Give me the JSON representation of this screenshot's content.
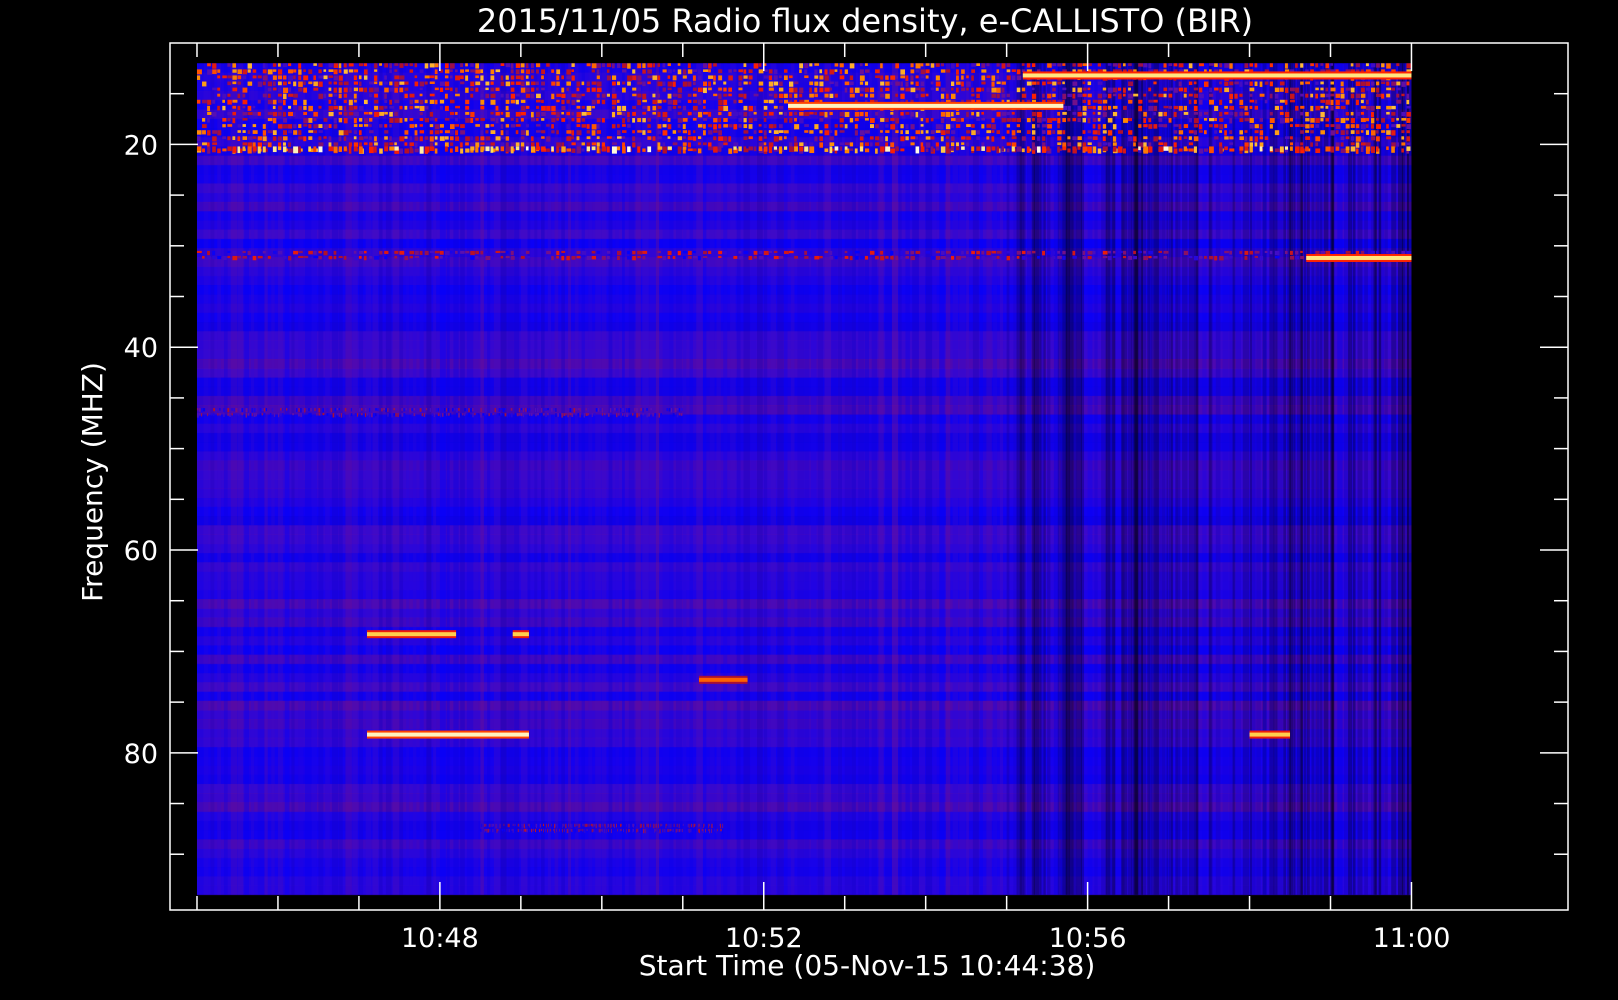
{
  "chart_data": {
    "type": "heatmap",
    "title": "2015/11/05  Radio flux density, e-CALLISTO (BIR)",
    "xlabel": "Start Time (05-Nov-15 10:44:38)",
    "ylabel": "Frequency (MHZ)",
    "x_start_time": "10:45:15",
    "x_end_time": "11:00:00",
    "xlim_minutes": [
      -0.3333,
      16.9333
    ],
    "ylim_mhz": [
      95.5,
      10
    ],
    "x_ticks": [
      {
        "label": "10:48",
        "minute": 3
      },
      {
        "label": "10:52",
        "minute": 7
      },
      {
        "label": "10:56",
        "minute": 11
      },
      {
        "label": "11:00",
        "minute": 15
      }
    ],
    "x_minor_ticks_minutes": [
      0,
      1,
      2,
      3,
      4,
      5,
      6,
      7,
      8,
      9,
      10,
      11,
      12,
      13,
      14,
      15
    ],
    "y_ticks": [
      {
        "label": "20",
        "mhz": 20
      },
      {
        "label": "40",
        "mhz": 40
      },
      {
        "label": "60",
        "mhz": 60
      },
      {
        "label": "80",
        "mhz": 80
      }
    ],
    "y_minor_ticks_mhz": [
      15,
      25,
      30,
      35,
      45,
      50,
      55,
      65,
      70,
      75,
      85,
      90
    ],
    "freq_range_mhz": [
      12,
      94
    ],
    "colormap": [
      "#000000",
      "#1a00b0",
      "#0000ff",
      "#5a10b0",
      "#b0102a",
      "#ff2000",
      "#ff8c00",
      "#ffe060",
      "#ffffff"
    ],
    "background_color": "#1c00e8",
    "interference_bands": [
      {
        "mhz_from": 12,
        "mhz_to": 21,
        "intensity": 0.75,
        "minute_from": 0,
        "minute_to": 15
      },
      {
        "mhz_from": 20.2,
        "mhz_to": 21,
        "intensity": 0.9,
        "minute_from": 0,
        "minute_to": 15
      },
      {
        "mhz_from": 30.5,
        "mhz_to": 31.5,
        "intensity": 0.55,
        "minute_from": 0,
        "minute_to": 15
      },
      {
        "mhz_from": 46,
        "mhz_to": 47,
        "intensity": 0.45,
        "minute_from": 0,
        "minute_to": 6
      },
      {
        "mhz_from": 87,
        "mhz_to": 88,
        "intensity": 0.5,
        "minute_from": 3.5,
        "minute_to": 6.5
      }
    ],
    "bursts": [
      {
        "minute_from": 2.1,
        "minute_to": 4.1,
        "mhz": 78.2,
        "intensity": 0.95
      },
      {
        "minute_from": 2.1,
        "minute_to": 3.2,
        "mhz": 68.3,
        "intensity": 0.85
      },
      {
        "minute_from": 3.9,
        "minute_to": 4.1,
        "mhz": 68.3,
        "intensity": 0.85
      },
      {
        "minute_from": 6.2,
        "minute_to": 6.8,
        "mhz": 72.8,
        "intensity": 0.7
      },
      {
        "minute_from": 13.0,
        "minute_to": 13.5,
        "mhz": 78.2,
        "intensity": 0.85
      },
      {
        "minute_from": 13.7,
        "minute_to": 15.0,
        "mhz": 31.2,
        "intensity": 0.9
      },
      {
        "minute_from": 10.2,
        "minute_to": 15.0,
        "mhz": 13.2,
        "intensity": 0.9
      },
      {
        "minute_from": 7.3,
        "minute_to": 10.7,
        "mhz": 16.2,
        "intensity": 0.95
      }
    ],
    "dark_region": {
      "minute_from": 10.0,
      "minute_to": 15.0,
      "intensity": 0.35
    }
  }
}
